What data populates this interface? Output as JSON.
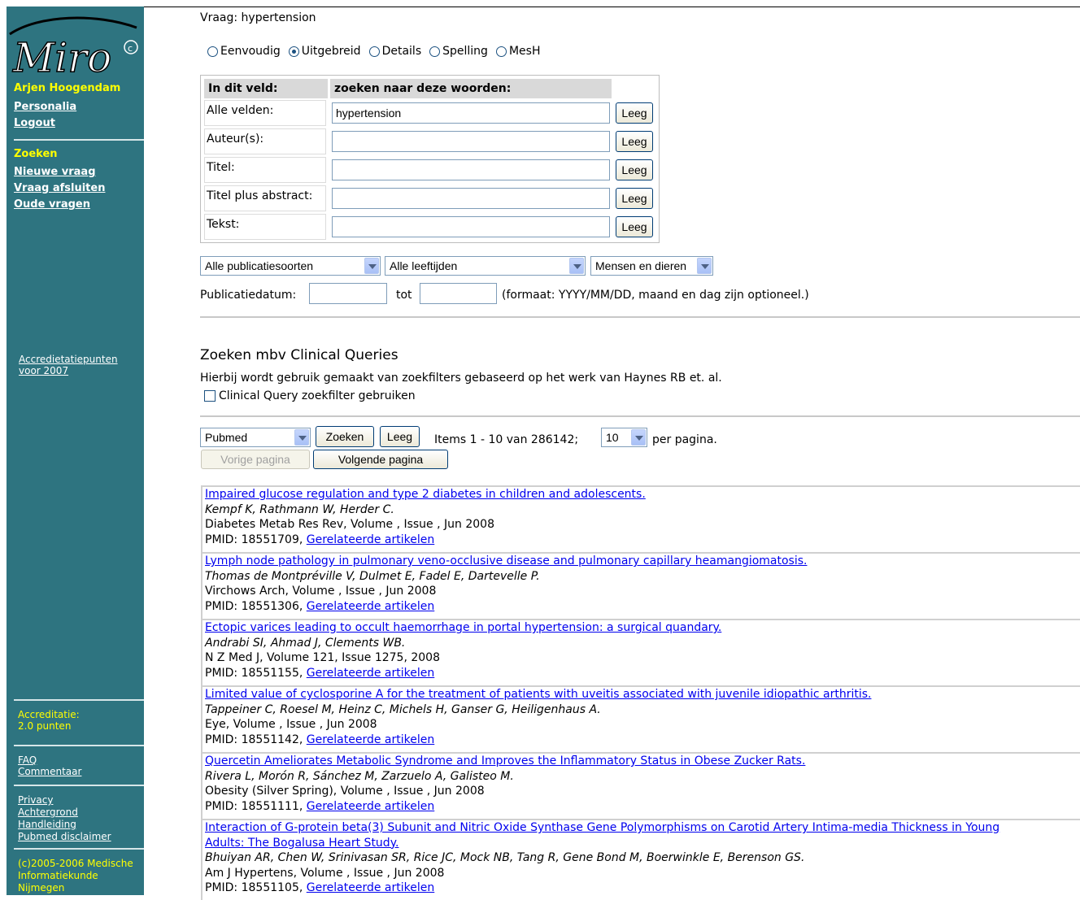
{
  "sidebar": {
    "logo_text": "Miro",
    "user_name": "Arjen Hoogendam",
    "user_links": [
      "Personalia",
      "Logout"
    ],
    "section_heading": "Zoeken",
    "search_links": [
      "Nieuwe vraag",
      "Vraag afsluiten",
      "Oude vragen"
    ],
    "accreditation_link_line1": "Accredietatiepunten",
    "accreditation_link_line2": "voor 2007",
    "accreditation_label": "Accreditatie:",
    "accreditation_value": "2.0 punten",
    "help_links": [
      "FAQ",
      "Commentaar"
    ],
    "info_links": [
      "Privacy",
      "Achtergrond",
      "Handleiding",
      "Pubmed disclaimer"
    ],
    "copyright_lines": [
      "(c)2005-2006 Medische",
      "Informatiekunde",
      "Nijmegen"
    ]
  },
  "query": {
    "label": "Vraag: hypertension",
    "modes": [
      "Eenvoudig",
      "Uitgebreid",
      "Details",
      "Spelling",
      "MesH"
    ],
    "selected_mode": "Uitgebreid"
  },
  "fields": {
    "header_field": "In dit veld:",
    "header_words": "zoeken naar deze woorden:",
    "rows": [
      {
        "label": "Alle velden:",
        "value": "hypertension"
      },
      {
        "label": "Auteur(s):",
        "value": ""
      },
      {
        "label": "Titel:",
        "value": ""
      },
      {
        "label": "Titel plus abstract:",
        "value": ""
      },
      {
        "label": "Tekst:",
        "value": ""
      }
    ],
    "clear_label": "Leeg"
  },
  "filters": {
    "publication_type": "Alle publicatiesoorten",
    "age": "Alle leeftijden",
    "species": "Mensen en dieren",
    "date_label": "Publicatiedatum:",
    "date_from": "",
    "date_to_label": "tot",
    "date_to": "",
    "date_hint": "(formaat: YYYY/MM/DD, maand en dag zijn optioneel.)"
  },
  "clinical": {
    "heading": "Zoeken mbv Clinical Queries",
    "description": "Hierbij wordt gebruik gemaakt van zoekfilters gebaseerd op het werk van Haynes RB et. al.",
    "checkbox_label": "Clinical Query zoekfilter gebruiken",
    "checked": false
  },
  "search_bar": {
    "database": "Pubmed",
    "search_label": "Zoeken",
    "clear_label": "Leeg",
    "items_text": "Items 1 - 10 van 286142;",
    "per_page_value": "10",
    "per_page_label": "per pagina.",
    "prev_label": "Vorige pagina",
    "next_label": "Volgende pagina"
  },
  "results": [
    {
      "title": "Impaired glucose regulation and type 2 diabetes in children and adolescents.",
      "title_line2": "",
      "authors": "Kempf K, Rathmann W, Herder C.",
      "source": "Diabetes Metab Res Rev, Volume , Issue , Jun 2008",
      "pmid": "PMID: 18551709,",
      "related": "Gerelateerde artikelen"
    },
    {
      "title": "Lymph node pathology in pulmonary veno-occlusive disease and pulmonary capillary heamangiomatosis.",
      "title_line2": "",
      "authors": "Thomas de Montpréville V, Dulmet E, Fadel E, Dartevelle P.",
      "source": "Virchows Arch, Volume , Issue , Jun 2008",
      "pmid": "PMID: 18551306,",
      "related": "Gerelateerde artikelen"
    },
    {
      "title": "Ectopic varices leading to occult haemorrhage in portal hypertension: a surgical quandary.",
      "title_line2": "",
      "authors": "Andrabi SI, Ahmad J, Clements WB.",
      "source": "N Z Med J, Volume 121, Issue 1275, 2008",
      "pmid": "PMID: 18551155,",
      "related": "Gerelateerde artikelen"
    },
    {
      "title": "Limited value of cyclosporine A for the treatment of patients with uveitis associated with juvenile idiopathic arthritis.",
      "title_line2": "",
      "authors": "Tappeiner C, Roesel M, Heinz C, Michels H, Ganser G, Heiligenhaus A.",
      "source": "Eye, Volume , Issue , Jun 2008",
      "pmid": "PMID: 18551142,",
      "related": "Gerelateerde artikelen"
    },
    {
      "title": "Quercetin Ameliorates Metabolic Syndrome and Improves the Inflammatory Status in Obese Zucker Rats.",
      "title_line2": "",
      "authors": "Rivera L, Morón R, Sánchez M, Zarzuelo A, Galisteo M.",
      "source": "Obesity (Silver Spring), Volume , Issue , Jun 2008",
      "pmid": "PMID: 18551111,",
      "related": "Gerelateerde artikelen"
    },
    {
      "title": "Interaction of G-protein beta(3) Subunit and Nitric Oxide Synthase Gene Polymorphisms on Carotid Artery Intima-media Thickness in Young",
      "title_line2": "Adults: The Bogalusa Heart Study.",
      "authors": "Bhuiyan AR, Chen W, Srinivasan SR, Rice JC, Mock NB, Tang R, Gene Bond M, Boerwinkle E, Berenson GS.",
      "source": "Am J Hypertens, Volume , Issue , Jun 2008",
      "pmid": "PMID: 18551105,",
      "related": "Gerelateerde artikelen"
    }
  ],
  "colors": {
    "sidebar_bg": "#2e7480",
    "sidebar_heading": "#ffff00",
    "link": "#0000ee"
  }
}
